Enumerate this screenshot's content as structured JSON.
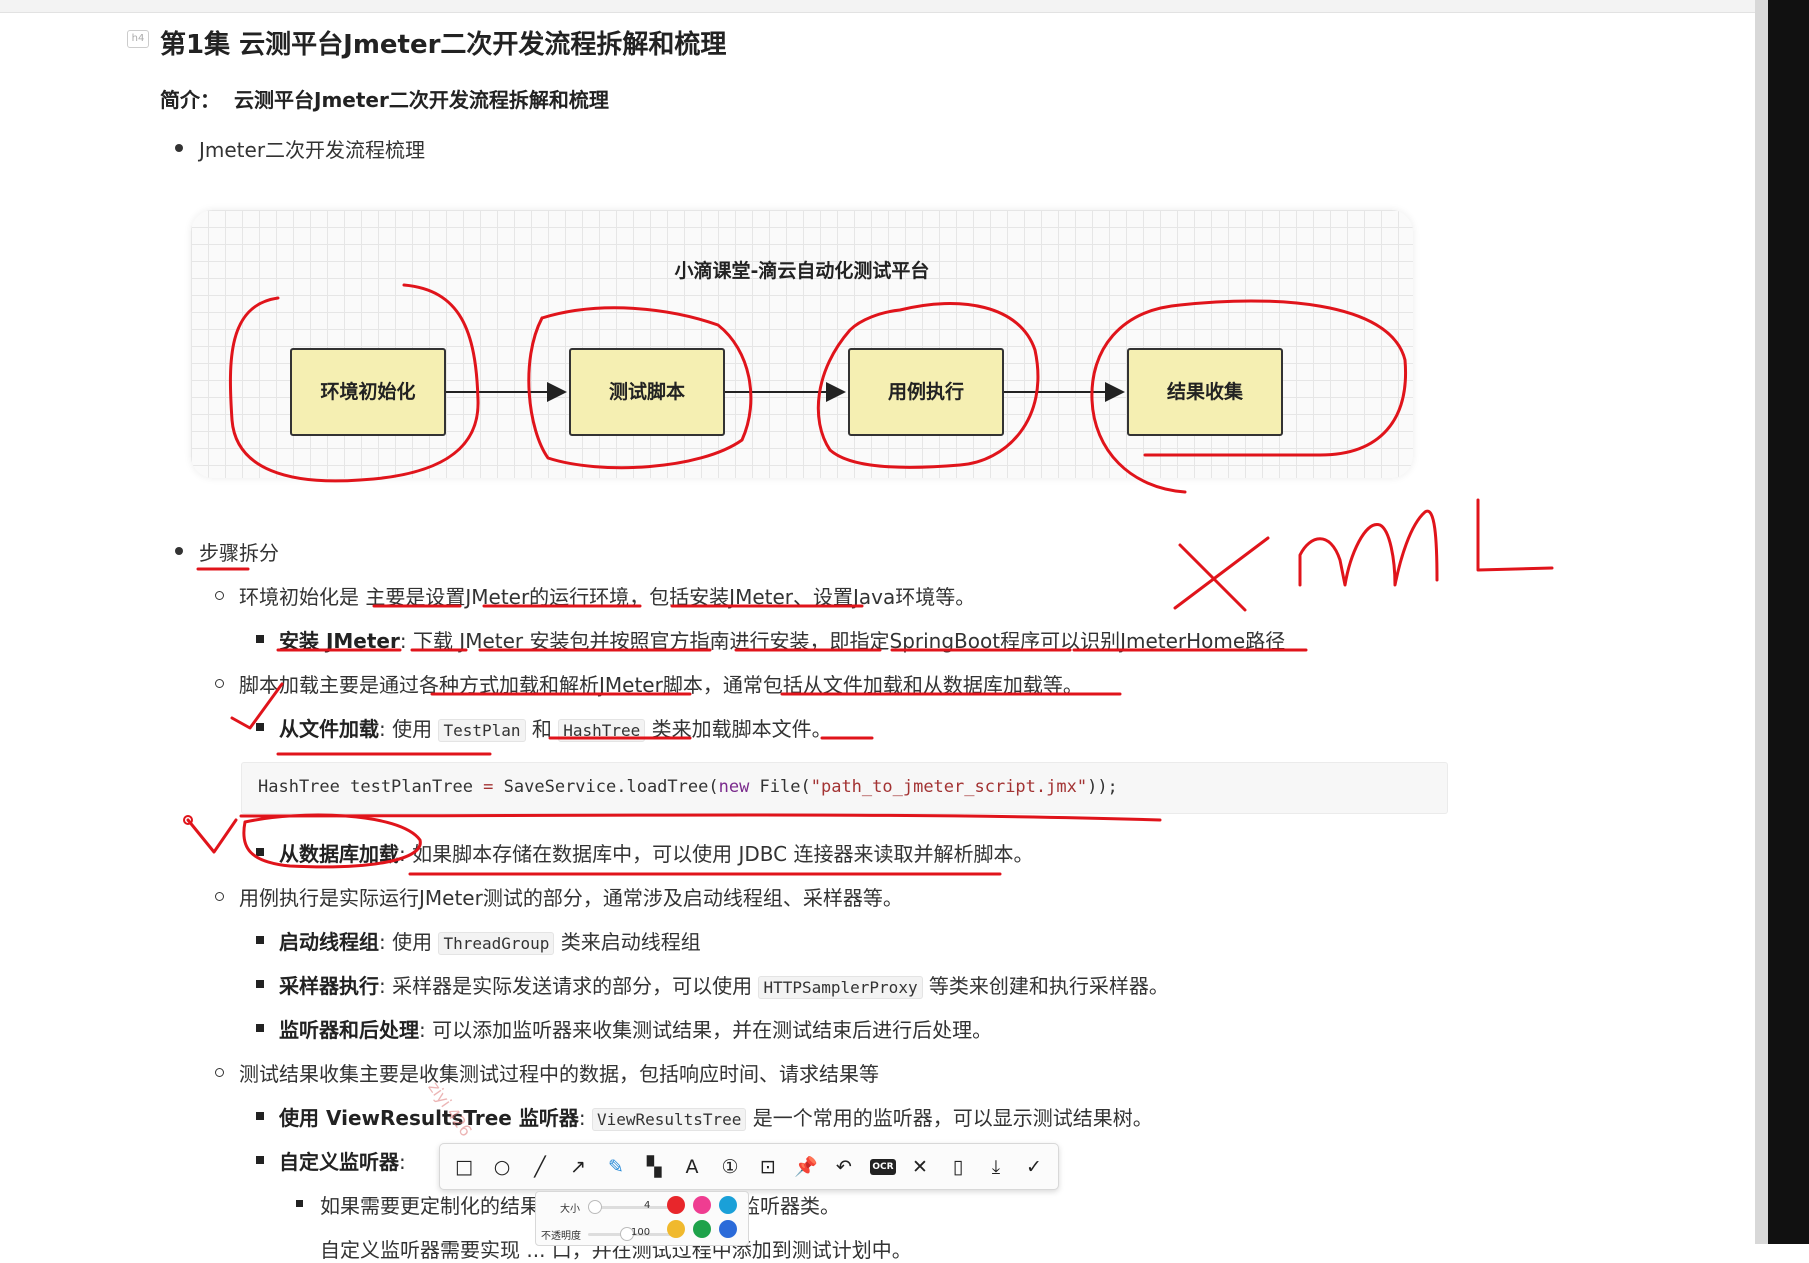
{
  "doc": {
    "heading_tag": "h4",
    "title": "第1集 云测平台Jmeter二次开发流程拆解和梳理",
    "intro_label": "简介：",
    "intro_text": "云测平台Jmeter二次开发流程拆解和梳理",
    "bullet1": "Jmeter二次开发流程梳理",
    "diagram": {
      "title": "小滴课堂-滴云自动化测试平台",
      "boxes": [
        "环境初始化",
        "测试脚本",
        "用例执行",
        "结果收集"
      ]
    },
    "bullet2": "步骤拆分",
    "steps": [
      {
        "text": "环境初始化是 主要是设置JMeter的运行环境，包括安装JMeter、设置Java环境等。",
        "subs": [
          {
            "bold": "安装 JMeter",
            "rest": ": 下载 JMeter 安装包并按照官方指南进行安装，即指定SpringBoot程序可以识别JmeterHome路径"
          }
        ]
      },
      {
        "text": "脚本加载主要是通过各种方式加载和解析JMeter脚本，通常包括从文件加载和从数据库加载等。",
        "subs": [
          {
            "bold": "从文件加载",
            "pre": ": 使用 ",
            "code1": "TestPlan",
            "mid": " 和 ",
            "code2": "HashTree",
            "rest": " 类来加载脚本文件。"
          },
          {
            "bold": "从数据库加载",
            "rest": ": 如果脚本存储在数据库中，可以使用 JDBC 连接器来读取并解析脚本。"
          }
        ],
        "code": {
          "p1": "HashTree testPlanTree ",
          "op": "=",
          "p2": " SaveService.loadTree(",
          "kw": "new",
          "p3": " File(",
          "str": "\"path_to_jmeter_script.jmx\"",
          "p4": "));"
        }
      },
      {
        "text": "用例执行是实际运行JMeter测试的部分，通常涉及启动线程组、采样器等。",
        "subs": [
          {
            "bold": "启动线程组",
            "pre": ": 使用 ",
            "code1": "ThreadGroup",
            "rest": " 类来启动线程组"
          },
          {
            "bold": "采样器执行",
            "pre": ": 采样器是实际发送请求的部分，可以使用 ",
            "code1": "HTTPSamplerProxy",
            "rest": " 等类来创建和执行采样器。"
          },
          {
            "bold": "监听器和后处理",
            "rest": ": 可以添加监听器来收集测试结果，并在测试结束后进行后处理。"
          }
        ]
      },
      {
        "text": "测试结果收集主要是收集测试过程中的数据，包括响应时间、请求结果等",
        "subs": [
          {
            "bold": "使用 ViewResultsTree 监听器",
            "pre": ": ",
            "code1": "ViewResultsTree",
            "rest": " 是一个常用的监听器，可以显示测试结果树。"
          },
          {
            "bold": "自定义监听器",
            "rest": ":"
          }
        ],
        "sub_sub": "如果需要更定制化的结果收集，可以创建自定义监听器类。",
        "sub_sub2": "自定义监听器需要实现 ... 口，并在测试过程中添加到测试计划中。"
      }
    ]
  },
  "toolbar": {
    "icons": [
      "rectangle-tool",
      "ellipse-tool",
      "line-tool",
      "arrow-tool",
      "pen-tool",
      "mosaic-tool",
      "text-tool",
      "number-tool",
      "pin-image-tool",
      "pin-tool",
      "undo-tool",
      "ocr-tool",
      "close-tool",
      "scroll-capture-tool",
      "save-tool",
      "confirm-tool"
    ],
    "glyphs": [
      "□",
      "○",
      "╱",
      "↗",
      "✎",
      "▚",
      "A",
      "①",
      "⊡",
      "📌",
      "↶",
      "OCR",
      "✕",
      "▯",
      "⤓",
      "✓"
    ],
    "size_label": "大小",
    "size_value": "4",
    "opacity_label": "不透明度",
    "opacity_value": "100",
    "colors": [
      "#e8262b",
      "#ef3d91",
      "#1aa0d8",
      "#f0b92d",
      "#1ea24a",
      "#2a6ad9"
    ]
  },
  "annotations": {
    "handwriting": "xmL",
    "watermark": "ziyi 426"
  }
}
